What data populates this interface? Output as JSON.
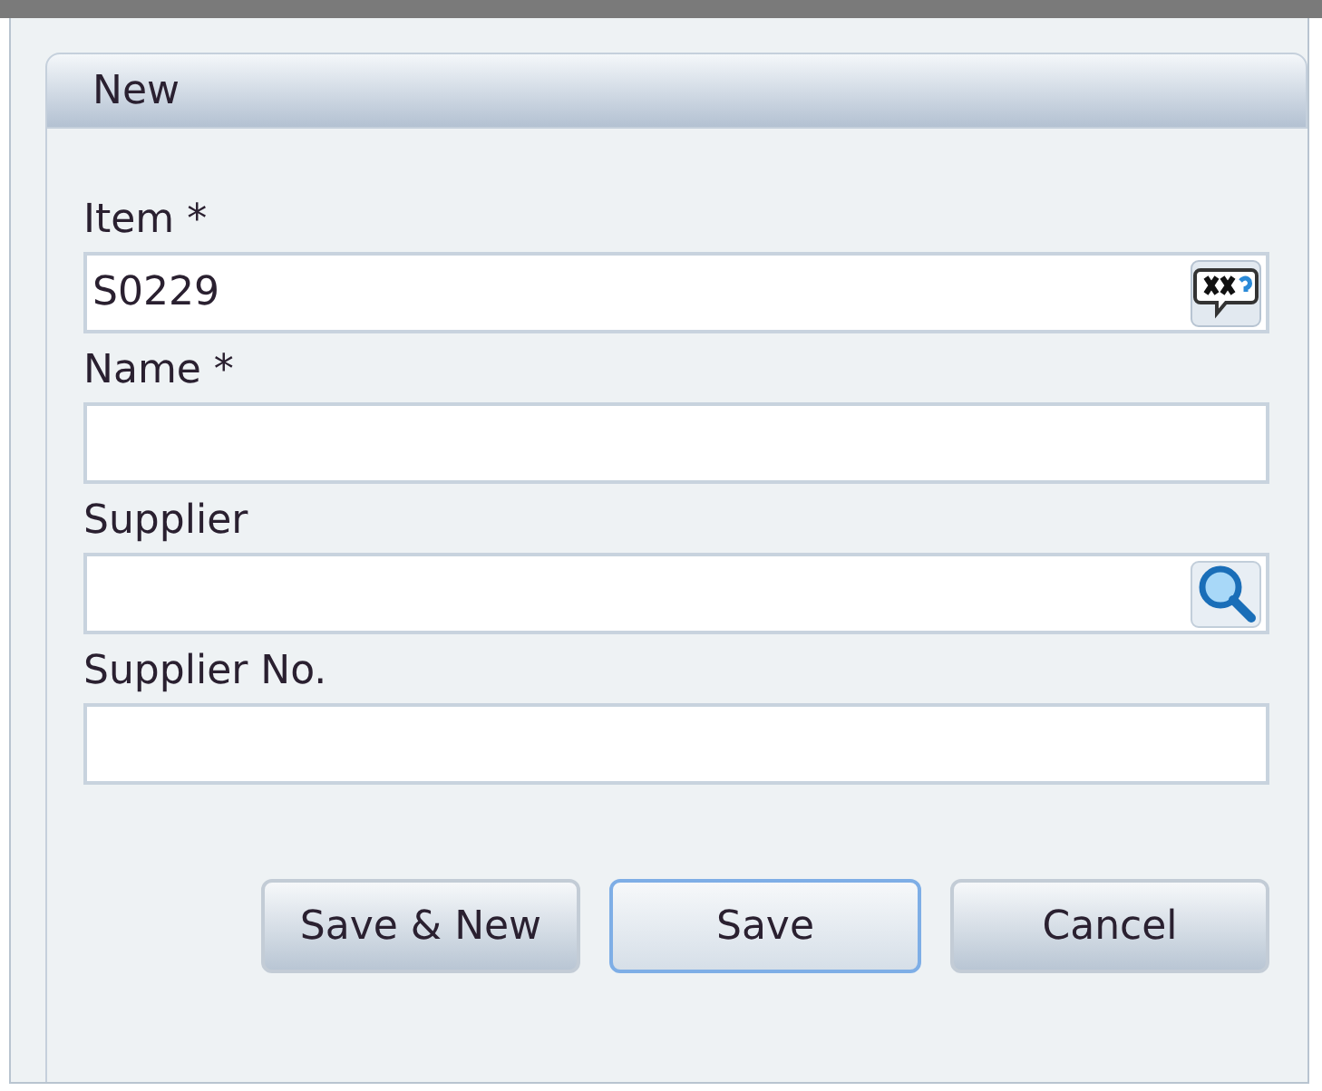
{
  "panel": {
    "title": "New"
  },
  "fields": [
    {
      "label": "Item *",
      "value": "S0229",
      "kind": "lookup"
    },
    {
      "label": "Name *",
      "kind": "text"
    },
    {
      "label": "Supplier",
      "kind": "search"
    },
    {
      "label": "Supplier No.",
      "kind": "text"
    }
  ],
  "buttons": [
    {
      "label": "Save & New",
      "focused": false
    },
    {
      "label": "Save",
      "focused": true
    },
    {
      "label": "Cancel",
      "focused": false
    }
  ]
}
